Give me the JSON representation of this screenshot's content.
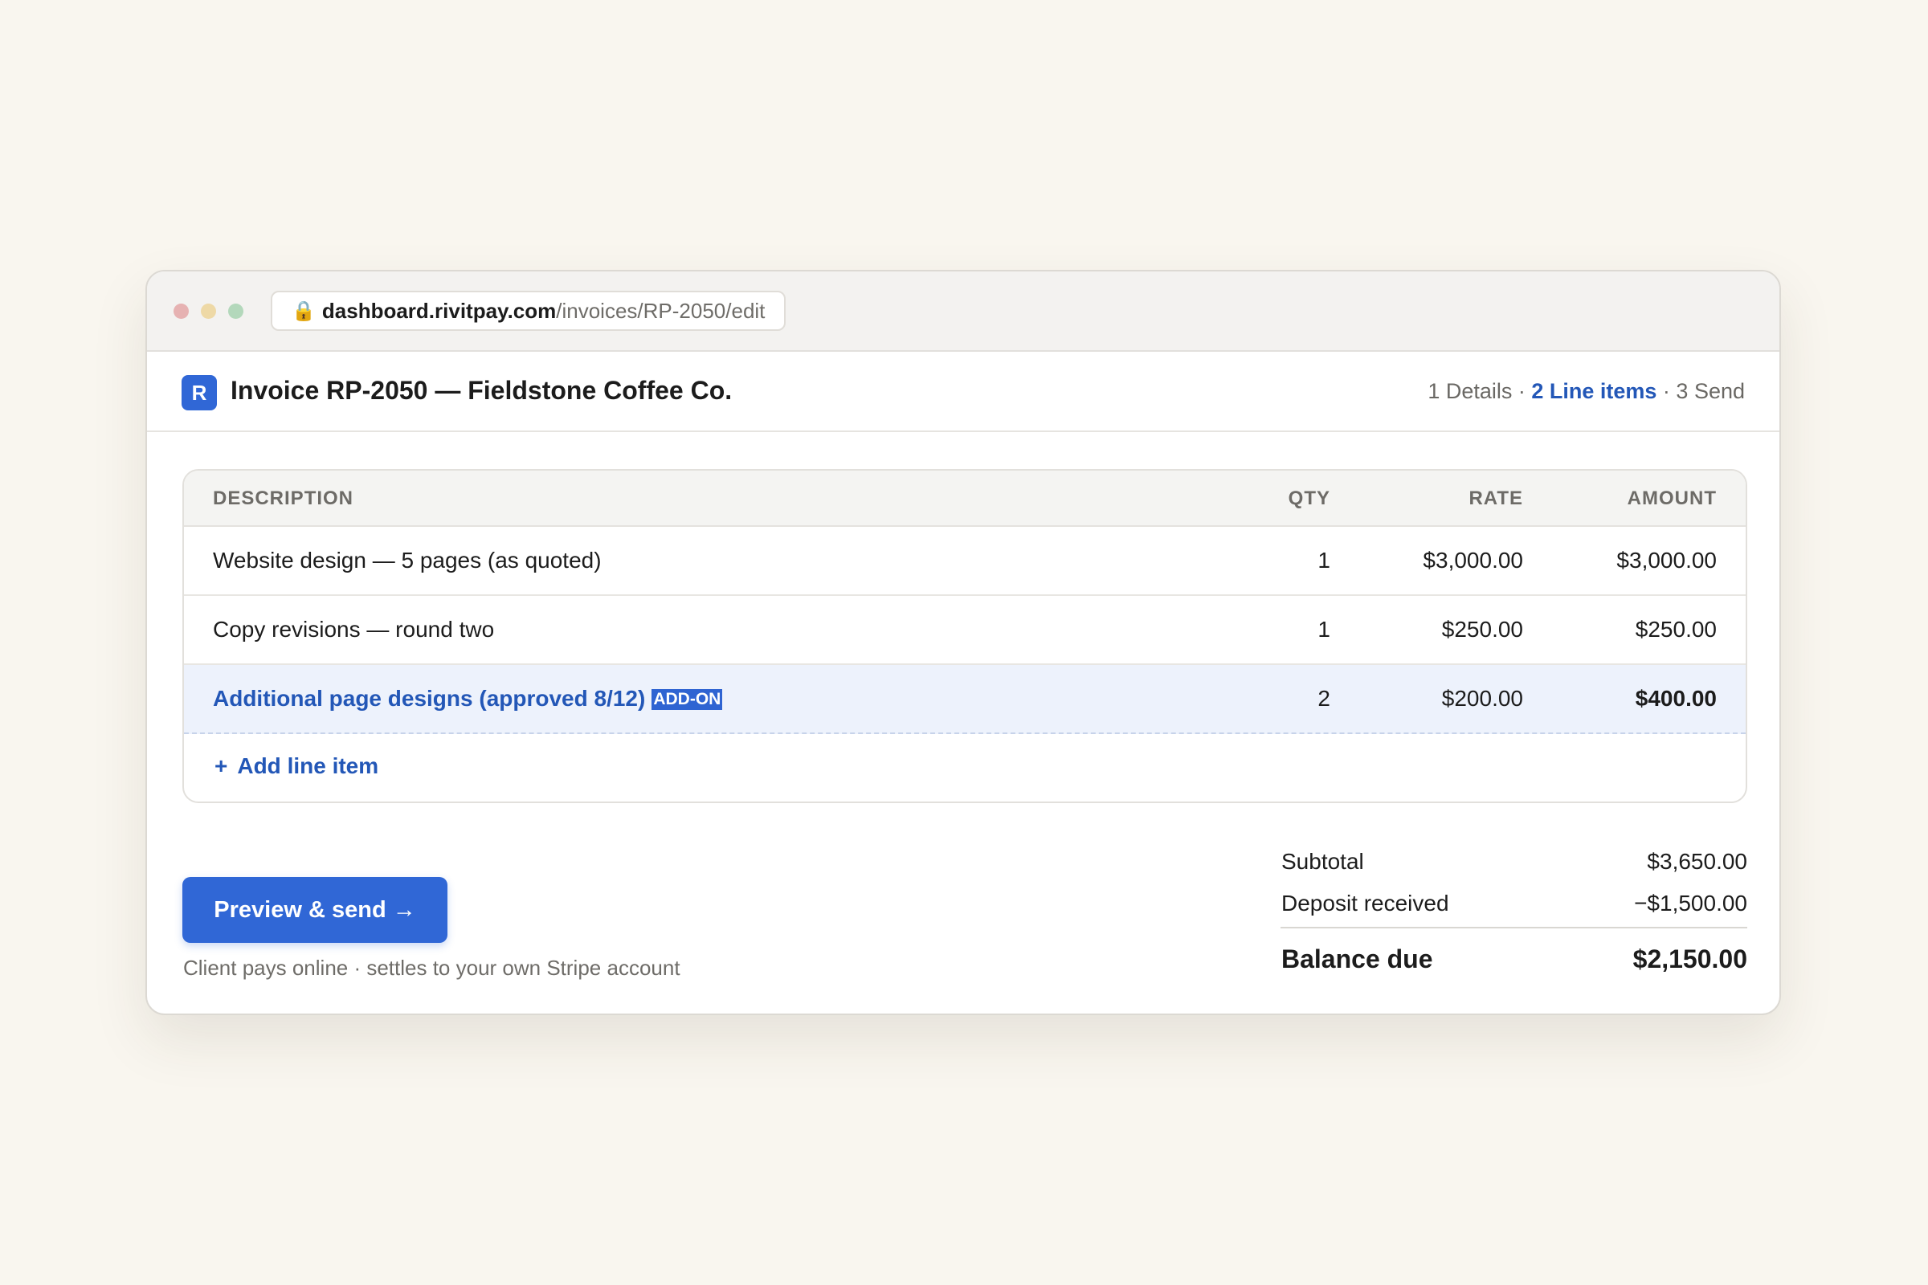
{
  "browser": {
    "url_host": "dashboard.rivitpay.com",
    "url_path": "/invoices/RP-2050/edit",
    "lock_icon": "🔒"
  },
  "app": {
    "logo_letter": "R",
    "title": "Invoice RP-2050 — Fieldstone Coffee Co.",
    "steps": [
      "1 Details",
      "2 Line items",
      "3 Send"
    ],
    "step_separator": " · ",
    "active_step": "2 Line items"
  },
  "table": {
    "headers": {
      "description": "DESCRIPTION",
      "qty": "QTY",
      "rate": "RATE",
      "amount": "AMOUNT"
    },
    "rows": [
      {
        "description": "Website design — 5 pages (as quoted)",
        "qty": "1",
        "rate": "$3,000.00",
        "amount": "$3,000.00"
      },
      {
        "description": "Copy revisions — round two",
        "qty": "1",
        "rate": "$250.00",
        "amount": "$250.00"
      },
      {
        "description": "Additional page designs (approved 8/12)",
        "badge": "ADD-ON",
        "qty": "2",
        "rate": "$200.00",
        "amount": "$400.00"
      }
    ],
    "add_label": "Add line item",
    "add_icon": "+"
  },
  "actions": {
    "primary_label": "Preview & send →",
    "footnote": "Client pays online · settles to your own Stripe account"
  },
  "totals": {
    "subtotal_label": "Subtotal",
    "subtotal_value": "$3,650.00",
    "deposit_label": "Deposit received",
    "deposit_value": "−$1,500.00",
    "balance_label": "Balance due",
    "balance_value": "$2,150.00"
  },
  "colors": {
    "accent": "#3067d6",
    "link": "#2357b7",
    "highlight_row": "#edf2fc",
    "page_background": "#f9f6ef"
  }
}
